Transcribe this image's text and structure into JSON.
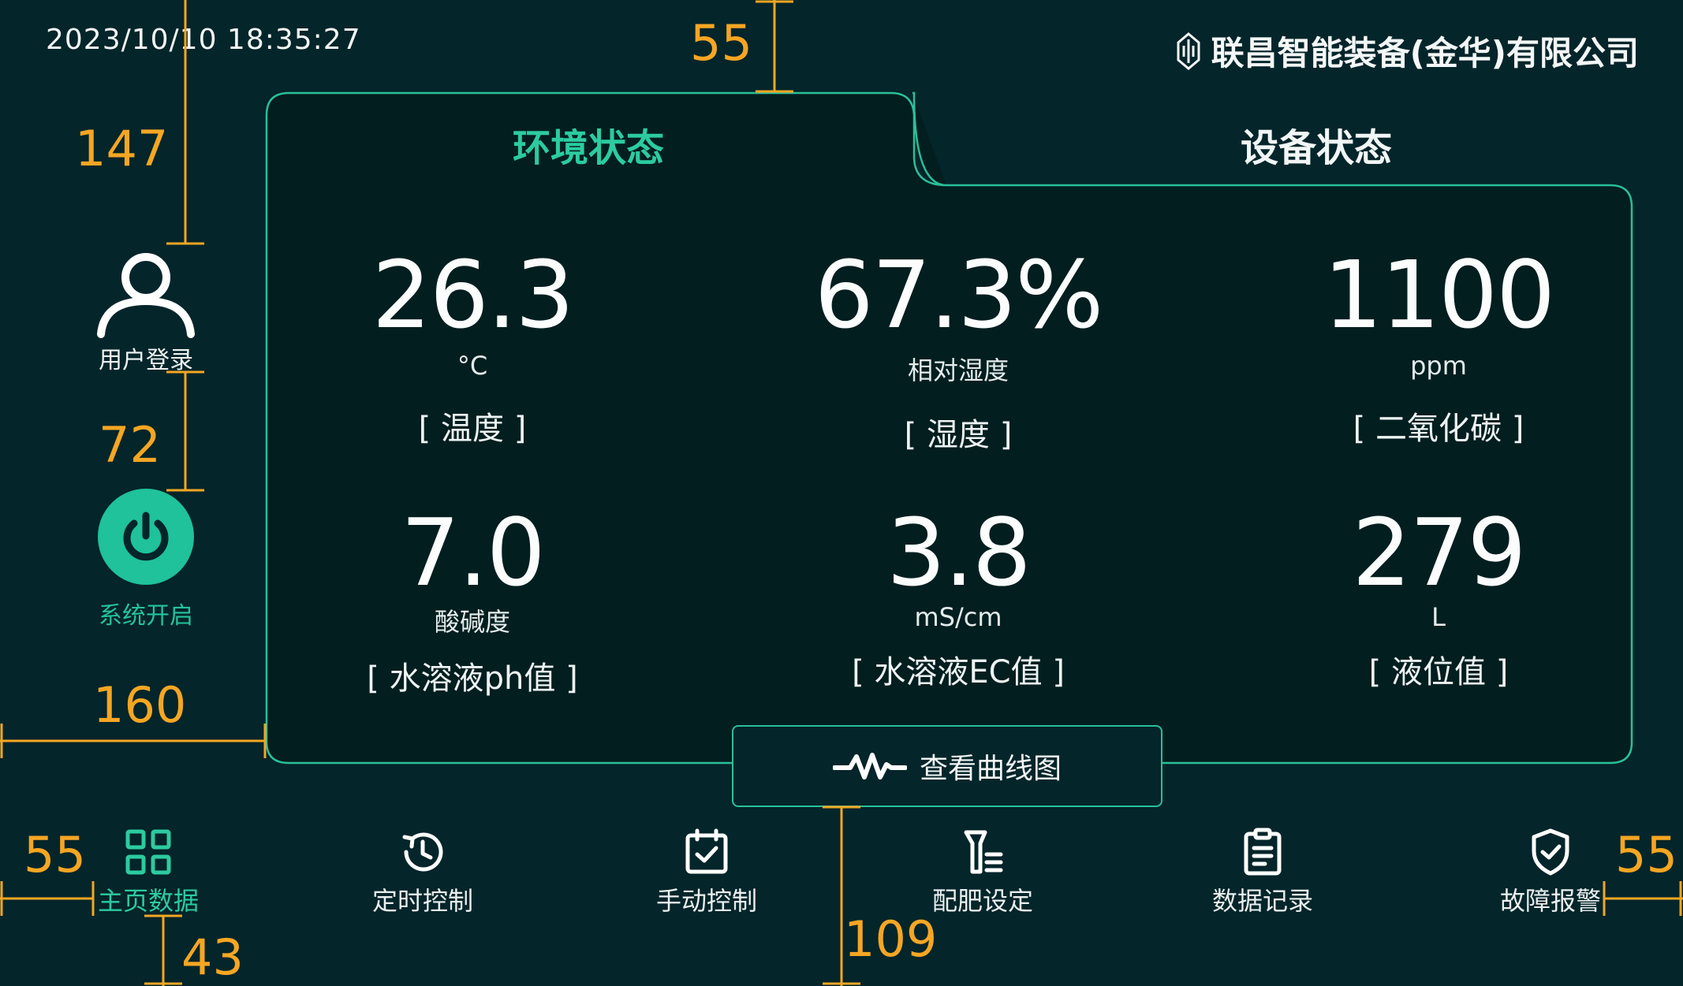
{
  "header": {
    "datetime": "2023/10/10 18:35:27",
    "company": "联昌智能装备(金华)有限公司"
  },
  "sidebar": {
    "login_label": "用户登录",
    "power_label": "系统开启"
  },
  "tabs": [
    {
      "label": "环境状态",
      "active": true
    },
    {
      "label": "设备状态",
      "active": false
    }
  ],
  "metrics": [
    {
      "value": "26.3",
      "unit": "°C",
      "name": "[ 温度 ]"
    },
    {
      "value": "67.3%",
      "unit": "相对湿度",
      "name": "[ 湿度 ]"
    },
    {
      "value": "1100",
      "unit": "ppm",
      "name": "[ 二氧化碳 ]"
    },
    {
      "value": "7.0",
      "unit": "酸碱度",
      "name": "[ 水溶液ph值 ]"
    },
    {
      "value": "3.8",
      "unit": "mS/cm",
      "name": "[ 水溶液EC值 ]"
    },
    {
      "value": "279",
      "unit": "L",
      "name": "[ 液位值 ]"
    }
  ],
  "curve_button": {
    "label": "查看曲线图",
    "icon": "waveform-icon"
  },
  "bottom_nav": [
    {
      "label": "主页数据",
      "icon": "grid-icon",
      "active": true
    },
    {
      "label": "定时控制",
      "icon": "clock-icon",
      "active": false
    },
    {
      "label": "手动控制",
      "icon": "calendar-check-icon",
      "active": false
    },
    {
      "label": "配肥设定",
      "icon": "fertilizer-icon",
      "active": false
    },
    {
      "label": "数据记录",
      "icon": "clipboard-icon",
      "active": false
    },
    {
      "label": "故障报警",
      "icon": "shield-check-icon",
      "active": false
    }
  ],
  "annotations": {
    "top_gap": "55",
    "login_top": "147",
    "login_power_gap": "72",
    "left_margin": "160",
    "nav_left": "55",
    "nav_right": "55",
    "nav_bottom": "43",
    "button_nav_gap": "109"
  },
  "colors": {
    "background": "#04252a",
    "panel": "#031e1f",
    "accent": "#2ccba0",
    "annotation": "#f5a623"
  }
}
